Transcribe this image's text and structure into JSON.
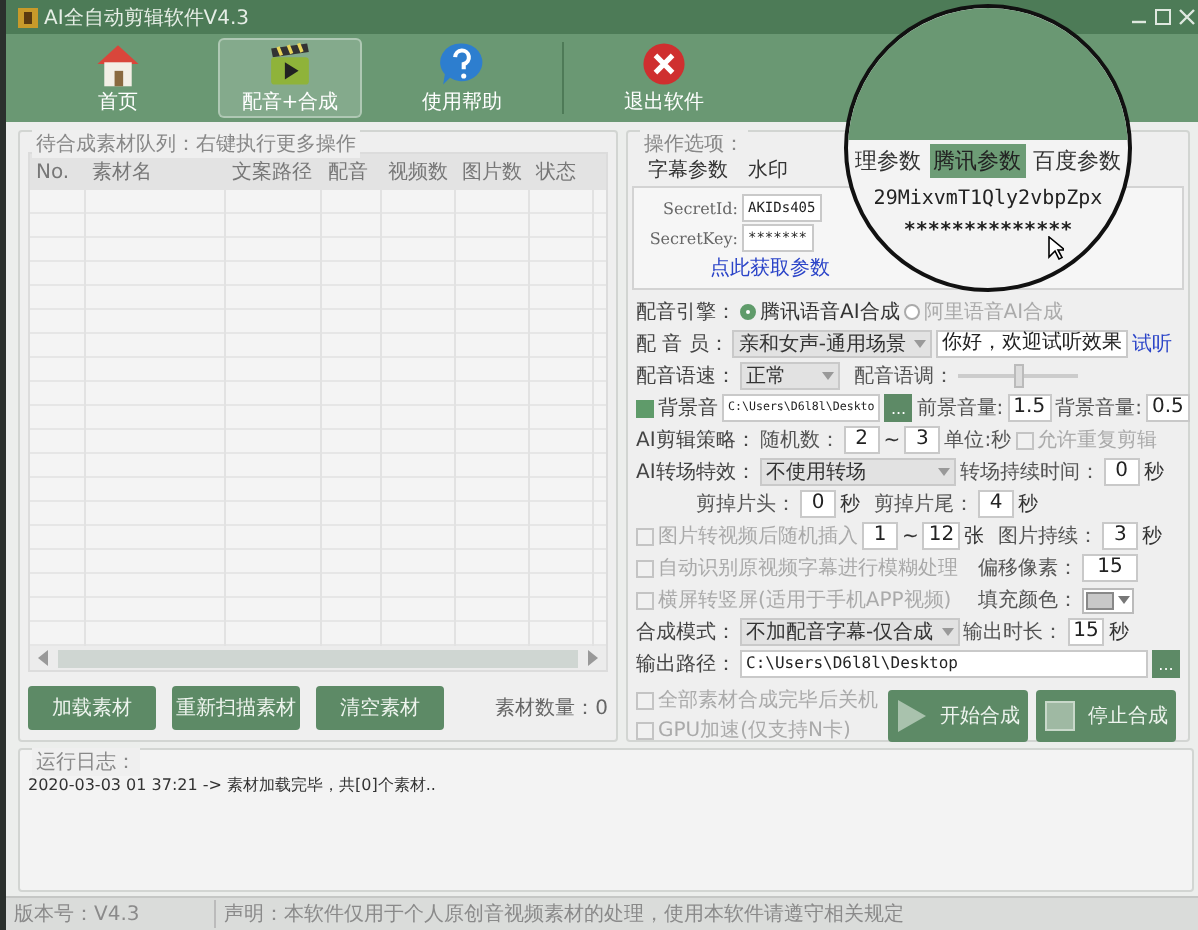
{
  "window": {
    "title": "AI全自动剪辑软件V4.3"
  },
  "toolbar": [
    {
      "label": "首页",
      "selected": false
    },
    {
      "label": "配音+合成",
      "selected": true
    },
    {
      "label": "使用帮助",
      "selected": false
    },
    {
      "label": "退出软件",
      "selected": false
    }
  ],
  "queue": {
    "title": "待合成素材队列：右键执行更多操作",
    "columns": [
      "No.",
      "素材名",
      "文案路径",
      "配音",
      "视频数",
      "图片数",
      "状态"
    ],
    "buttons": [
      "加载素材",
      "重新扫描素材",
      "清空素材"
    ],
    "count_label": "素材数量：0"
  },
  "log": {
    "title": "运行日志：",
    "lines": [
      "2020-03-03 01 37:21 -> 素材加载完毕，共[0]个素材.."
    ]
  },
  "options": {
    "title": "操作选项：",
    "tabs": [
      {
        "label": "字幕参数",
        "selected": false
      },
      {
        "label": "水印",
        "selected": false
      }
    ],
    "secret_id": {
      "label": "SecretId:",
      "value": "AKIDs405"
    },
    "secret_key": {
      "label": "SecretKey:",
      "value": "*******"
    },
    "link": "点此获取参数",
    "engine": {
      "label": "配音引擎：",
      "options": [
        {
          "label": "腾讯语音AI合成",
          "selected": true
        },
        {
          "label": "阿里语音AI合成",
          "selected": false
        }
      ]
    },
    "voice": {
      "label": "配 音 员：",
      "value": "亲和女声-通用场景",
      "sample": "你好，欢迎试听效果",
      "listen": "试听"
    },
    "speed": {
      "label": "配音语速：",
      "value": "正常",
      "pitch_label": "配音语调：",
      "level": 0.5
    },
    "bgm": {
      "label": "背景音",
      "checked": true,
      "path": "C:\\Users\\D6l8l\\Deskto",
      "browse": "...",
      "fg_label": "前景音量:",
      "fg_value": "1.5",
      "bg_label": "背景音量:",
      "bg_value": "0.5"
    },
    "cut": {
      "label": "AI剪辑策略：",
      "random_label": "随机数：",
      "min": "2",
      "sep": "~",
      "max": "3",
      "unit": "单位:秒",
      "repeat": {
        "label": "允许重复剪辑",
        "checked": false,
        "disabled": true
      }
    },
    "transition": {
      "label": "AI转场特效：",
      "value": "不使用转场",
      "dur_label": "转场持续时间：",
      "dur_value": "0",
      "unit": "秒"
    },
    "trim": {
      "head_label": "剪掉片头：",
      "head_value": "0",
      "head_unit": "秒",
      "tail_label": "剪掉片尾：",
      "tail_value": "4",
      "tail_unit": "秒"
    },
    "images": {
      "label": "图片转视频后随机插入",
      "checked": false,
      "disabled": true,
      "min": "1",
      "sep": "~",
      "max": "12",
      "unit": "张",
      "dur_label": "图片持续：",
      "dur_value": "3",
      "dur_unit": "秒"
    },
    "blur": {
      "label": "自动识别原视频字幕进行模糊处理",
      "checked": false,
      "disabled": true,
      "offset_label": "偏移像素：",
      "offset_value": "15"
    },
    "portrait": {
      "label": "横屏转竖屏(适用于手机APP视频)",
      "checked": false,
      "disabled": true,
      "fill_label": "填充颜色："
    },
    "mode": {
      "label": "合成模式：",
      "value": "不加配音字幕-仅合成",
      "len_label": "输出时长：",
      "len_value": "15",
      "unit": "秒"
    },
    "output": {
      "label": "输出路径：",
      "path": "C:\\Users\\D6l8l\\Desktop",
      "browse": "..."
    },
    "shutdown": {
      "label": "全部素材合成完毕后关机",
      "checked": false,
      "disabled": true
    },
    "gpu": {
      "label": "GPU加速(仅支持N卡)",
      "checked": false,
      "disabled": true
    },
    "start": "开始合成",
    "stop": "停止合成"
  },
  "magnifier": {
    "tabs": [
      {
        "label": "理参数",
        "selected": false
      },
      {
        "label": "腾讯参数",
        "selected": true
      },
      {
        "label": "百度参数",
        "selected": false
      }
    ],
    "secret_id": "29MixvmT1Qly2vbpZpx",
    "secret_key": "**************"
  },
  "status_bar": {
    "version": "版本号：V4.3",
    "notice": "声明：本软件仅用于个人原创音视频素材的处理，使用本软件请遵守相关规定"
  }
}
